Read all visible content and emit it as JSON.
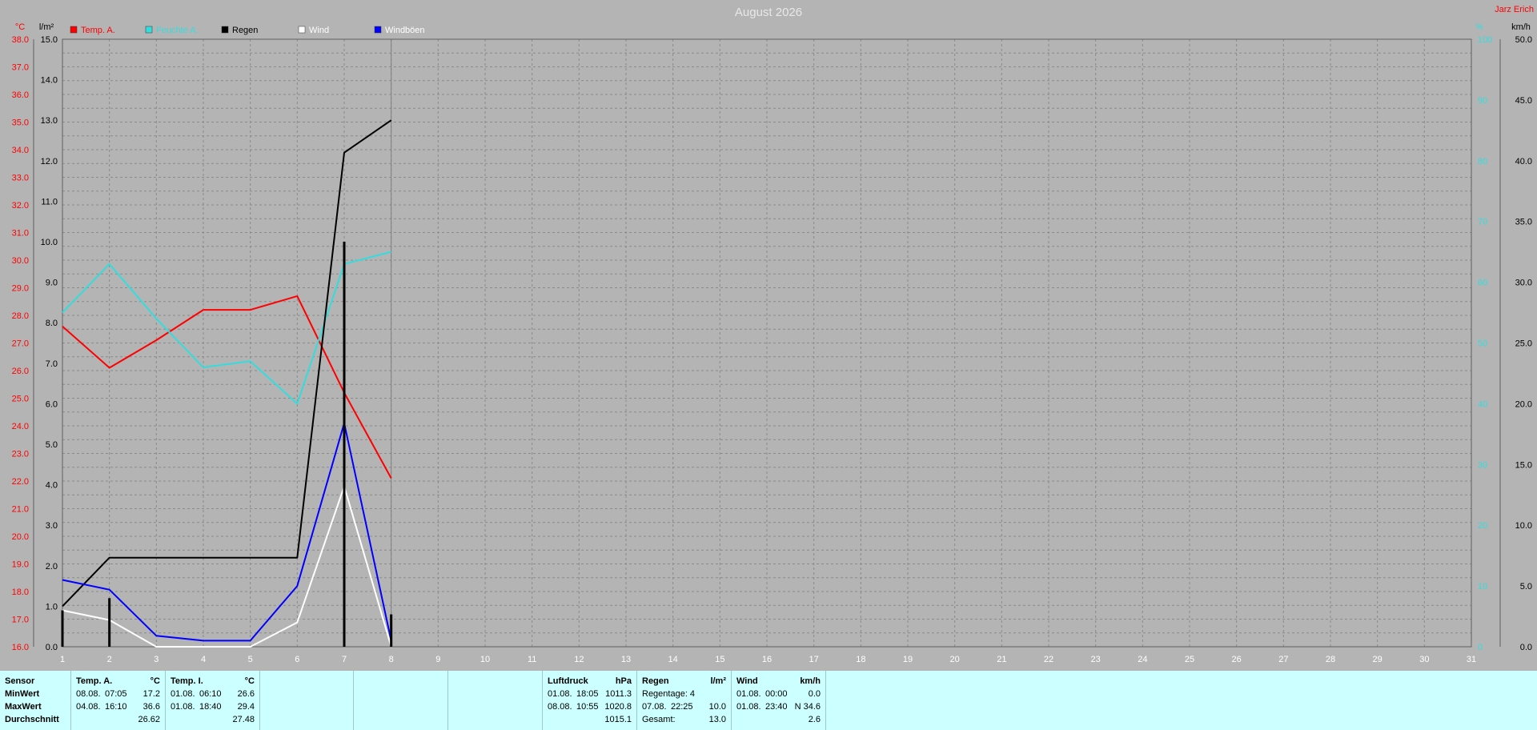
{
  "title": "August 2026",
  "author": "Jarz Erich",
  "colors": {
    "background": "#b4b4b4",
    "grid": "#8a8a8a",
    "temp_a": "#ff0000",
    "temp_i": "#33dddd",
    "regen": "#000000",
    "wind": "#ffffff",
    "windboeen": "#0000ff",
    "footer_bg": "#ccffff"
  },
  "chart_data": {
    "type": "line",
    "title": "August 2026",
    "grid": true,
    "legend_position": "top-left",
    "x": {
      "categories": [
        "1",
        "2",
        "3",
        "4",
        "5",
        "6",
        "7",
        "8",
        "9",
        "10",
        "11",
        "12",
        "13",
        "14",
        "15",
        "16",
        "17",
        "18",
        "19",
        "20",
        "21",
        "22",
        "23",
        "24",
        "25",
        "26",
        "27",
        "28",
        "29",
        "30",
        "31"
      ],
      "range": [
        1,
        31
      ]
    },
    "axes": {
      "temp": {
        "unit": "°C",
        "range": [
          16.0,
          38.0
        ],
        "step": 1.0,
        "ticks": [
          "16.0",
          "17.0",
          "18.0",
          "19.0",
          "20.0",
          "21.0",
          "22.0",
          "23.0",
          "24.0",
          "25.0",
          "26.0",
          "27.0",
          "28.0",
          "29.0",
          "30.0",
          "31.0",
          "32.0",
          "33.0",
          "34.0",
          "35.0",
          "36.0",
          "37.0",
          "38.0"
        ]
      },
      "rain": {
        "unit": "l/m²",
        "range": [
          0.0,
          15.0
        ],
        "step": 1.0,
        "ticks": [
          "0.0",
          "1.0",
          "2.0",
          "3.0",
          "4.0",
          "5.0",
          "6.0",
          "7.0",
          "8.0",
          "9.0",
          "10.0",
          "11.0",
          "12.0",
          "13.0",
          "14.0",
          "15.0"
        ]
      },
      "humidity": {
        "unit": "%",
        "range": [
          0,
          100
        ],
        "step": 10,
        "ticks": [
          "0",
          "10",
          "20",
          "30",
          "40",
          "50",
          "60",
          "70",
          "80",
          "90",
          "100"
        ]
      },
      "wind": {
        "unit": "km/h",
        "range": [
          0.0,
          50.0
        ],
        "step": 5.0,
        "ticks": [
          "0.0",
          "5.0",
          "10.0",
          "15.0",
          "20.0",
          "25.0",
          "30.0",
          "35.0",
          "40.0",
          "45.0",
          "50.0"
        ]
      }
    },
    "legend": [
      "Temp. A.",
      "Feuchte A.",
      "Regen",
      "Wind",
      "Windböen"
    ],
    "series": [
      {
        "name": "Temp. A.",
        "axis": "temp",
        "color": "#ff0000",
        "style": "line",
        "x": [
          1,
          2,
          3,
          4,
          5,
          6,
          7,
          8
        ],
        "values": [
          27.6,
          26.1,
          27.1,
          28.2,
          28.2,
          28.7,
          25.2,
          22.1
        ]
      },
      {
        "name": "Feuchte A.",
        "axis": "humidity",
        "color": "#33dddd",
        "style": "line",
        "x": [
          1,
          2,
          3,
          4,
          5,
          6,
          7,
          8
        ],
        "values": [
          55,
          63,
          54,
          46,
          47,
          40,
          63,
          65
        ]
      },
      {
        "name": "Regen",
        "axis": "rain",
        "color": "#000000",
        "style": "line",
        "x": [
          1,
          2,
          3,
          4,
          5,
          6,
          7,
          8
        ],
        "values": [
          1.0,
          2.2,
          2.2,
          2.2,
          2.2,
          2.2,
          12.2,
          13.0
        ]
      },
      {
        "name": "Wind",
        "axis": "wind",
        "color": "#ffffff",
        "style": "line",
        "x": [
          1,
          2,
          3,
          4,
          5,
          6,
          7,
          8
        ],
        "values": [
          3.0,
          2.2,
          0.0,
          0.0,
          0.0,
          2.0,
          13.2,
          0.0
        ]
      },
      {
        "name": "Windböen",
        "axis": "wind",
        "color": "#0000ff",
        "style": "line",
        "x": [
          1,
          2,
          3,
          4,
          5,
          6,
          7,
          8
        ],
        "values": [
          5.5,
          4.7,
          0.9,
          0.5,
          0.5,
          5.0,
          18.4,
          0.5
        ]
      },
      {
        "name": "Regen",
        "axis": "rain",
        "color": "#000000",
        "style": "bar",
        "x": [
          1,
          2,
          7,
          8
        ],
        "values": [
          0.9,
          1.2,
          10.0,
          0.8
        ]
      }
    ]
  },
  "footer": {
    "labels": {
      "sensor": "Sensor",
      "min": "MinWert",
      "max": "MaxWert",
      "avg": "Durchschnitt"
    },
    "temp_a": {
      "title": "Temp. A.",
      "unit": "°C",
      "min_date": "08.08.",
      "min_time": "07:05",
      "min_val": "17.2",
      "max_date": "04.08.",
      "max_time": "16:10",
      "max_val": "36.6",
      "avg": "26.62"
    },
    "temp_i": {
      "title": "Temp. I.",
      "unit": "°C",
      "min_date": "01.08.",
      "min_time": "06:10",
      "min_val": "26.6",
      "max_date": "01.08.",
      "max_time": "18:40",
      "max_val": "29.4",
      "avg": "27.48"
    },
    "luftdruck": {
      "title": "Luftdruck",
      "unit": "hPa",
      "min_date": "01.08.",
      "min_time": "18:05",
      "min_val": "1011.3",
      "max_date": "08.08.",
      "max_time": "10:55",
      "max_val": "1020.8",
      "avg": "1015.1"
    },
    "regen": {
      "title": "Regen",
      "unit": "l/m²",
      "days_label": "Regentage: 4",
      "max_date": "07.08.",
      "max_time": "22:25",
      "max_val": "10.0",
      "total_label": "Gesamt:",
      "total_val": "13.0"
    },
    "wind": {
      "title": "Wind",
      "unit": "km/h",
      "min_date": "01.08.",
      "min_time": "00:00",
      "min_val": "0.0",
      "max_date": "01.08.",
      "max_time": "23:40",
      "max_val": "N 34.6",
      "avg": "2.6"
    }
  }
}
